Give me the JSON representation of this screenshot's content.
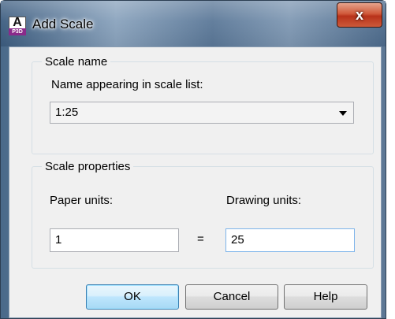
{
  "window": {
    "title": "Add Scale",
    "icon": "autocad-p3d-app-icon",
    "close_label": "x"
  },
  "scale_name_group": {
    "legend": "Scale name",
    "field_label": "Name appearing in scale list:",
    "selected_value": "1:25"
  },
  "scale_properties_group": {
    "legend": "Scale properties",
    "paper_units_label": "Paper units:",
    "drawing_units_label": "Drawing units:",
    "paper_units_value": "1",
    "equals_sign": "=",
    "drawing_units_value": "25"
  },
  "buttons": {
    "ok": "OK",
    "cancel": "Cancel",
    "help": "Help"
  }
}
